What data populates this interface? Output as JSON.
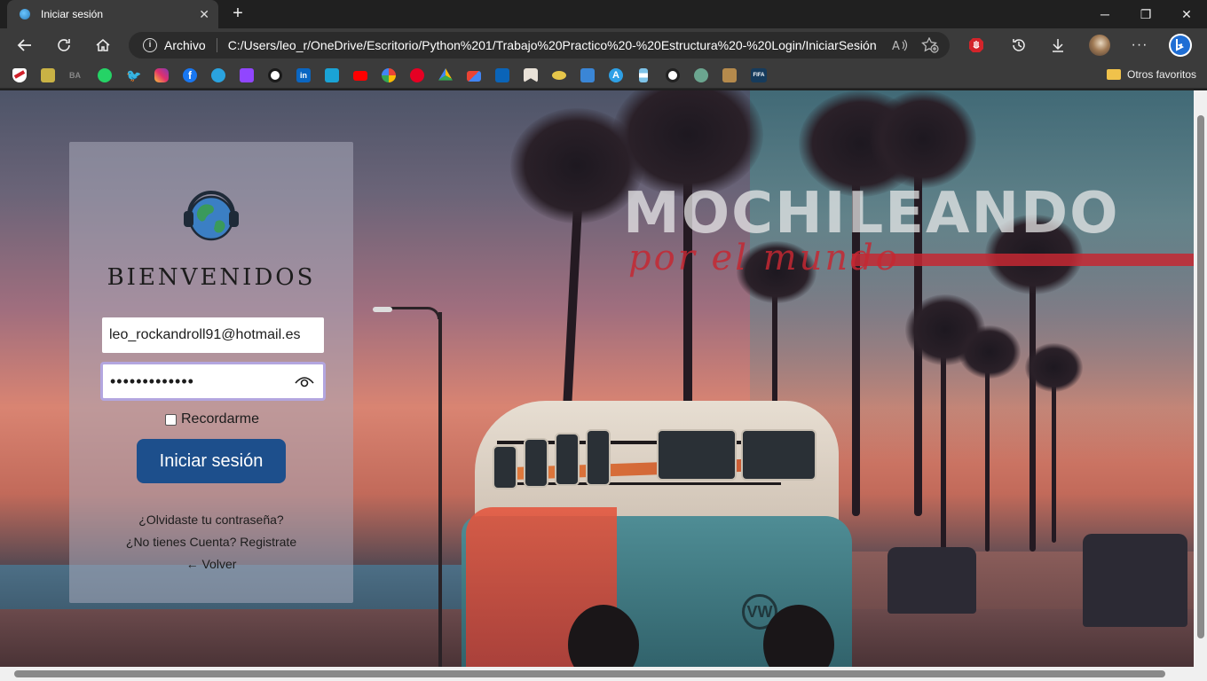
{
  "tab": {
    "title": "Iniciar sesión",
    "close_icon": "close-icon",
    "new_tab_icon": "plus-icon"
  },
  "window_controls": {
    "minimize": "minimize-icon",
    "maximize": "restore-icon",
    "close": "close-icon"
  },
  "toolbar": {
    "back_icon": "back-arrow-icon",
    "refresh_icon": "refresh-icon",
    "home_icon": "home-icon",
    "protocol_label": "Archivo",
    "url": "C:/Users/leo_r/OneDrive/Escritorio/Python%201/Trabajo%20Practico%20-%20Estructura%20-%20Login/IniciarSesión....",
    "read_aloud_icon": "read-aloud-icon",
    "favorite_icon": "add-favorite-icon",
    "extension_icon": "adblock-icon",
    "history_icon": "history-icon",
    "download_icon": "download-icon",
    "profile_icon": "profile-avatar",
    "menu_icon": "more-icon",
    "bing_icon": "bing-icon"
  },
  "bookmarks": {
    "items": [
      "river-plate-icon",
      "image-icon",
      "ba-icon",
      "whatsapp-icon",
      "twitter-icon",
      "instagram-icon",
      "facebook-icon",
      "telegram-icon",
      "twitch-icon",
      "github-icon",
      "linkedin-icon",
      "tp-icon",
      "youtube-icon",
      "pinwheel-icon",
      "pinterest-icon",
      "drive-icon",
      "gmail-icon",
      "outlook-icon",
      "bookmark-icon",
      "eye-icon",
      "mi-icon",
      "a-icon",
      "flag-icon",
      "soccer-icon",
      "chatgpt-icon",
      "box-icon",
      "fifa-icon"
    ],
    "folder_label": "Otros favoritos"
  },
  "brand": {
    "title": "MOCHILEANDO",
    "subtitle": "por el mundo"
  },
  "login": {
    "welcome": "BIENVENIDOS",
    "email_value": "leo_rockandroll91@hotmail.es",
    "password_value": "•••••••••••••",
    "show_password_icon": "eye-icon",
    "remember_label": "Recordarme",
    "submit_label": "Iniciar sesión",
    "forgot_link": "¿Olvidaste tu contraseña?",
    "register_link": "¿No tienes Cuenta? Registrate",
    "back_link": "← Volver"
  },
  "colors": {
    "submit_bg": "#1d4f8c",
    "password_focus": "#b3a6df",
    "brand_red": "#c42832"
  }
}
